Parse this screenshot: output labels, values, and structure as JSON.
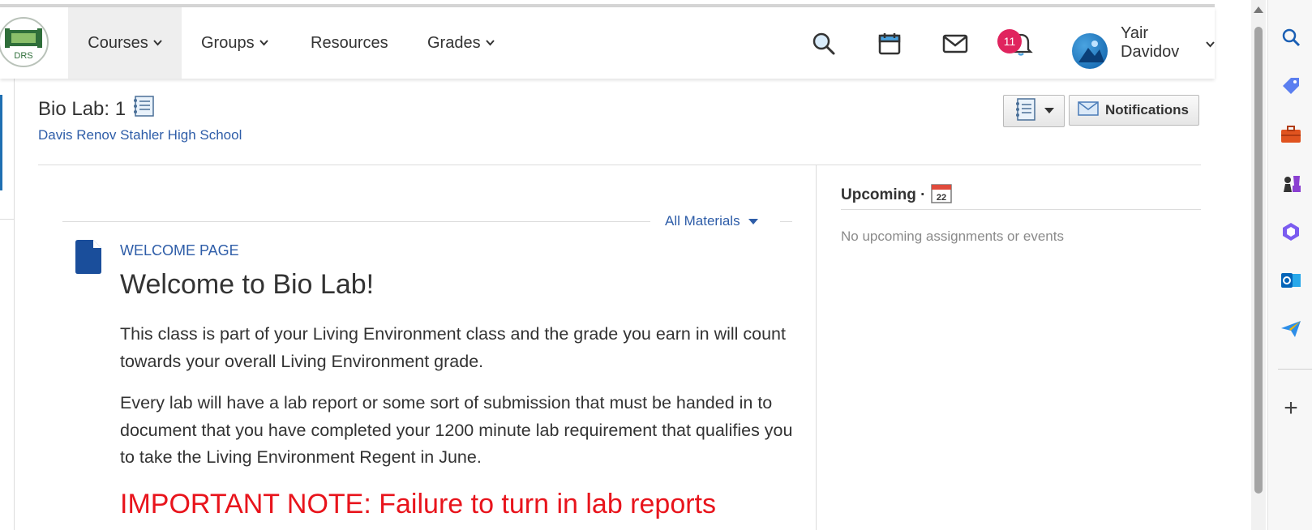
{
  "nav": {
    "logo_alt": "DRS",
    "items": [
      {
        "label": "Courses",
        "dropdown": true,
        "active": true
      },
      {
        "label": "Groups",
        "dropdown": true,
        "active": false
      },
      {
        "label": "Resources",
        "dropdown": false,
        "active": false
      },
      {
        "label": "Grades",
        "dropdown": true,
        "active": false
      }
    ],
    "icons": [
      "search-icon",
      "calendar-icon",
      "mail-icon",
      "bell-icon"
    ],
    "notification_count": "11",
    "user_name": "Yair Davidov"
  },
  "course": {
    "title": "Bio Lab: 1",
    "school": "Davis Renov Stahler High School",
    "notifications_button": "Notifications"
  },
  "materials": {
    "filter_label": "All Materials",
    "item_type": "WELCOME PAGE",
    "heading": "Welcome to Bio Lab!",
    "paragraph1": "This class is part of your Living Environment class and the grade you earn in will count towards your overall Living Environment grade.",
    "paragraph2": "Every lab will have a lab report or some sort of submission that must be handed in to document that you have completed your 1200 minute lab requirement that qualifies you to take the Living Environment Regent in June.",
    "important_note": "IMPORTANT NOTE:  Failure to turn in lab reports"
  },
  "upcoming": {
    "title": "Upcoming ·",
    "calendar_day": "22",
    "empty_text": "No upcoming assignments or events"
  },
  "edge_sidebar": {
    "icons": [
      "search-icon",
      "tag-icon",
      "briefcase-icon",
      "chess-icon",
      "copilot-icon",
      "outlook-icon",
      "send-icon",
      "add-icon"
    ]
  },
  "colors": {
    "link_blue": "#2e5da8",
    "important_red": "#e8141c",
    "badge": "#e0245e"
  }
}
